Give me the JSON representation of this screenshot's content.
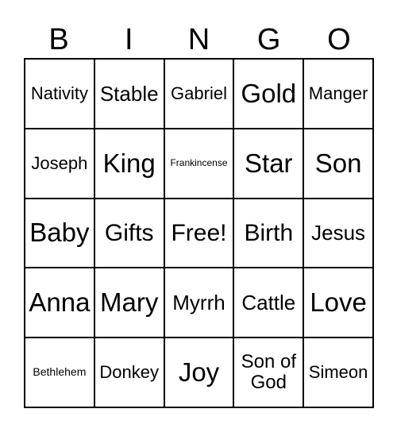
{
  "header": [
    "B",
    "I",
    "N",
    "G",
    "O"
  ],
  "cells": [
    "Nativity",
    "Stable",
    "Gabriel",
    "Gold",
    "Manger",
    "Joseph",
    "King",
    "Frankincense",
    "Star",
    "Son",
    "Baby",
    "Gifts",
    "Free!",
    "Birth",
    "Jesus",
    "Anna",
    "Mary",
    "Myrrh",
    "Cattle",
    "Love",
    "Bethlehem",
    "Donkey",
    "Joy",
    "Son of God",
    "Simeon"
  ]
}
